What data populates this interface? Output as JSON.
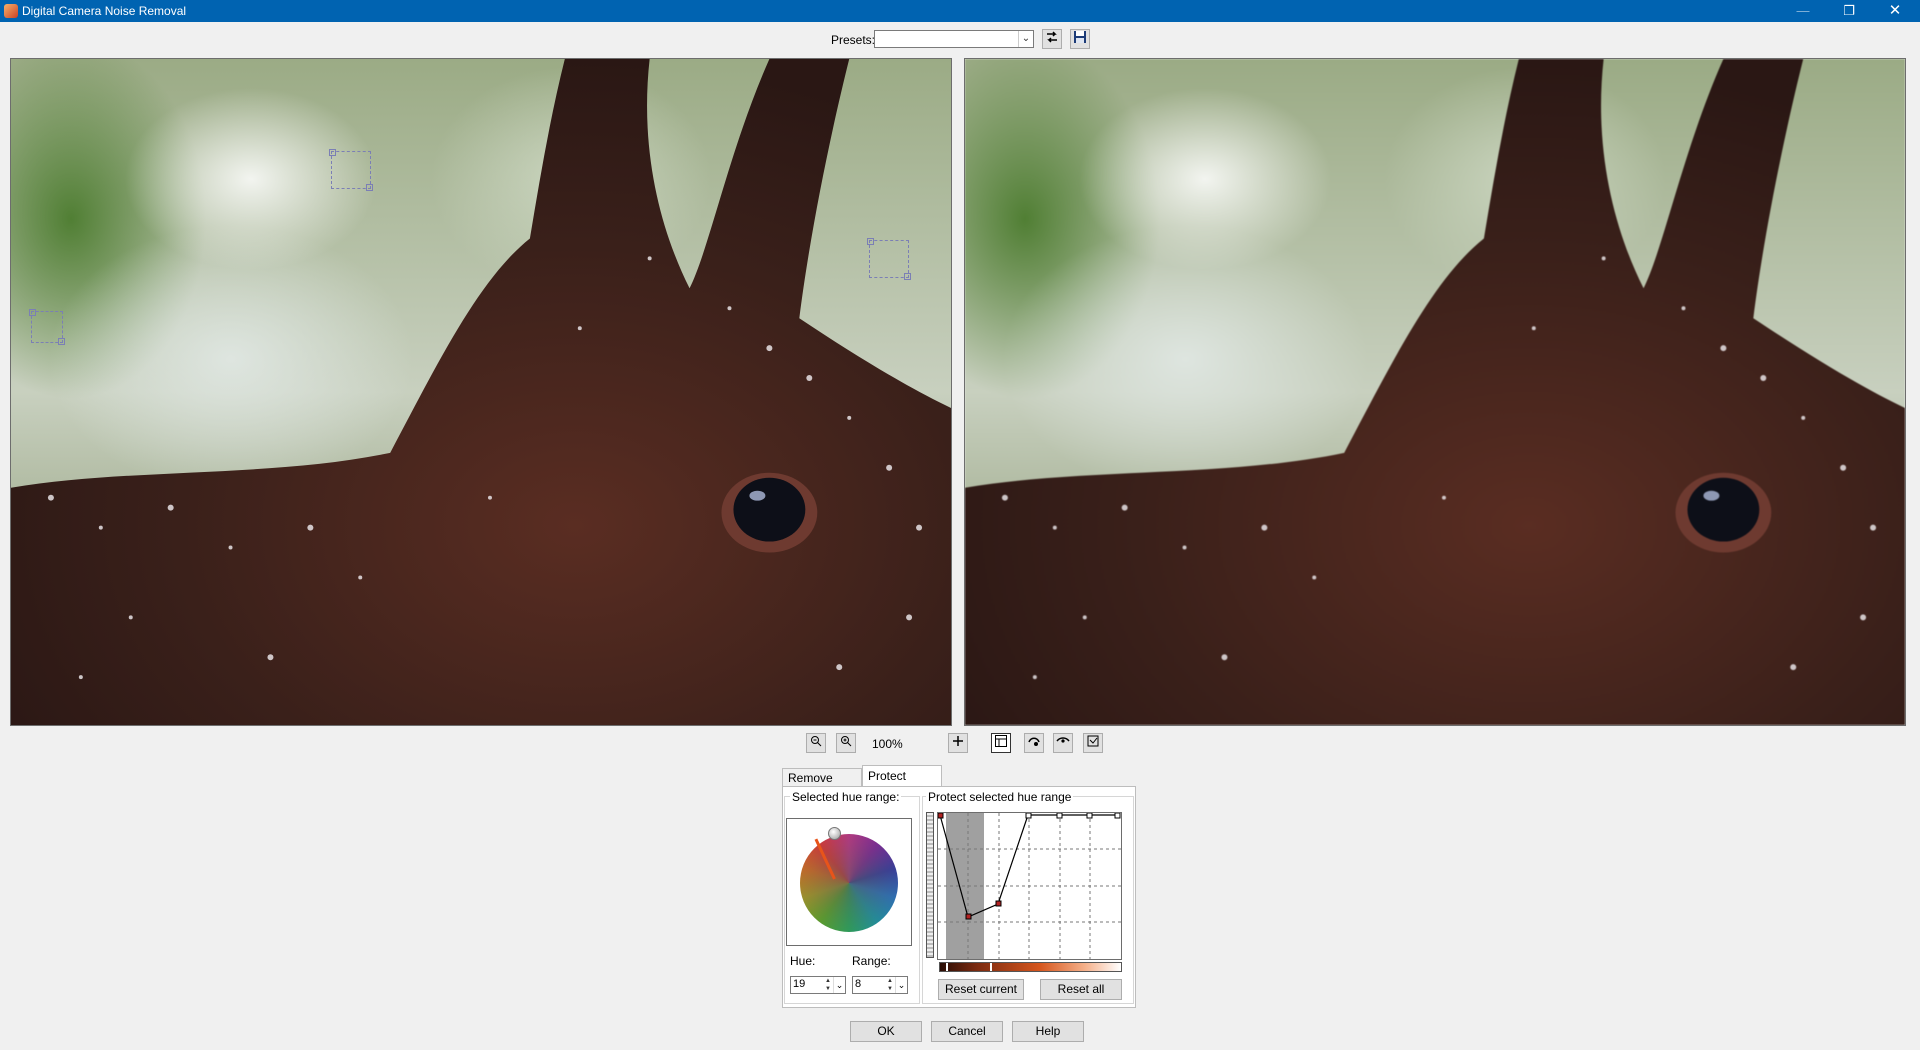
{
  "window": {
    "title": "Digital Camera Noise Removal",
    "minimize_glyph": "—",
    "restore_glyph": "❐",
    "close_glyph": "✕"
  },
  "presets": {
    "label": "Presets:",
    "value": ""
  },
  "toolbar": {
    "zoom_level": "100%",
    "icons": [
      "zoom-out-icon",
      "zoom-in-icon",
      "pan-icon",
      "split-view-icon",
      "pick-noise-icon",
      "preview-eye-icon",
      "auto-sample-icon"
    ]
  },
  "tabs": [
    {
      "label": "Remove Noise",
      "active": false
    },
    {
      "label": "Protect Image",
      "active": true
    }
  ],
  "hue_group": {
    "title": "Selected hue range:",
    "hue_label": "Hue:",
    "hue_value": "19",
    "range_label": "Range:",
    "range_value": "8"
  },
  "protect_group": {
    "title": "Protect selected hue range",
    "reset_current": "Reset current",
    "reset_all": "Reset all"
  },
  "dialog_buttons": {
    "ok": "OK",
    "cancel": "Cancel",
    "help": "Help"
  },
  "colors": {
    "titlebar": "#0063b1",
    "curve_point": "#b22222"
  }
}
